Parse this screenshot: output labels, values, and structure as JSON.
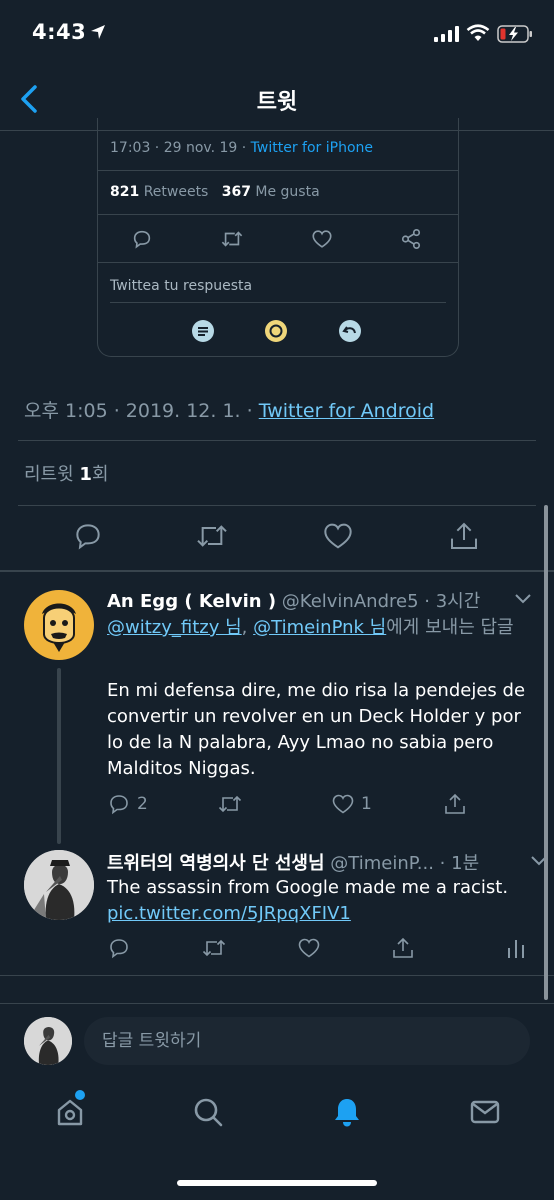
{
  "status": {
    "time": "4:43"
  },
  "nav": {
    "title": "트윗"
  },
  "embedded": {
    "time": "17:03 · 29 nov. 19 · ",
    "source": "Twitter for iPhone",
    "retweets_num": "821",
    "retweets_label": "Retweets",
    "likes_num": "367",
    "likes_label": "Me gusta",
    "reply_placeholder": "Twittea tu respuesta"
  },
  "tweet": {
    "datetime": "오후 1:05 · 2019. 12. 1. · ",
    "source": "Twitter for Android",
    "retweet_label": "리트윗 ",
    "retweet_count": "1",
    "retweet_suffix": "회"
  },
  "replies": [
    {
      "name": "An Egg ( Kelvin )",
      "handle": "@KelvinAndre5",
      "time": " · 3시간",
      "mention1": "@witzy_fitzy 님",
      "mention_sep": ", ",
      "mention2": "@TimeinPnk 님",
      "to_suffix": "에게 보내는 답글",
      "text": "En mi defensa dire, me dio risa la pendejes de convertir un revolver en un Deck Holder y por lo de la N palabra, Ayy Lmao no sabia pero Malditos Niggas.",
      "reply_count": "2",
      "like_count": "1"
    },
    {
      "name": "트위터의 역병의사 단 선생님",
      "handle": "@TimeinP...",
      "time": " · 1분",
      "text": "The assassin from Google made me a racist. ",
      "link": "pic.twitter.com/5JRpqXFIV1"
    }
  ],
  "compose": {
    "placeholder": "답글 트윗하기"
  },
  "colors": {
    "background": "#15202b",
    "accent": "#1da1f2",
    "link": "#71c9f8",
    "muted": "#8899a6",
    "border": "#38444d"
  }
}
